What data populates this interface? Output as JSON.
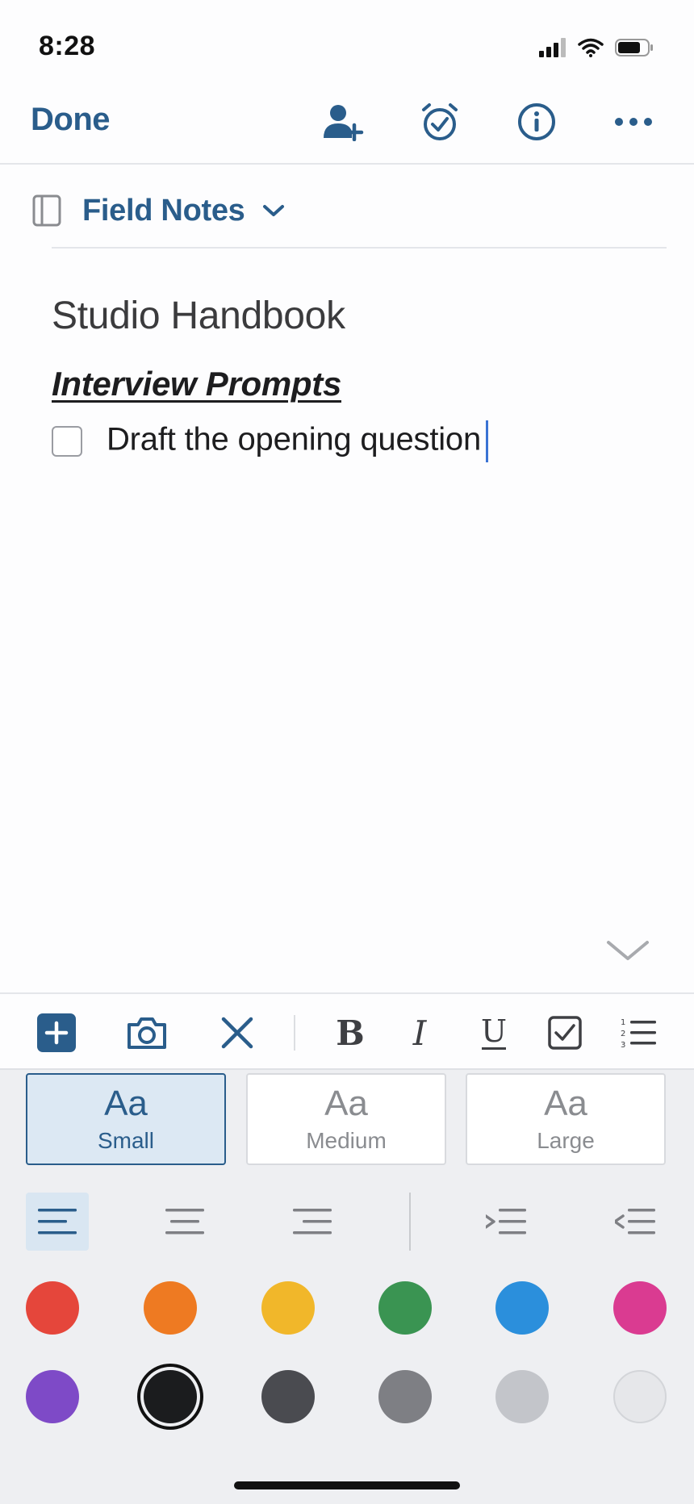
{
  "status": {
    "time": "8:28"
  },
  "toolbar": {
    "done_label": "Done"
  },
  "notebook": {
    "name": "Field Notes"
  },
  "note": {
    "title": "Studio Handbook",
    "heading": "Interview Prompts",
    "todo_text": "Draft the opening question"
  },
  "text_sizes": [
    {
      "aa": "Aa",
      "label": "Small",
      "active": true
    },
    {
      "aa": "Aa",
      "label": "Medium",
      "active": false
    },
    {
      "aa": "Aa",
      "label": "Large",
      "active": false
    }
  ],
  "colors": {
    "accent": "#2a5d8b",
    "swatches": [
      "#e5463b",
      "#ee7a22",
      "#f1b72a",
      "#3a9452",
      "#2b8fdc",
      "#da3b91",
      "#7e4ac7",
      "#1b1c1e",
      "#4a4b50",
      "#7e7f84",
      "#c3c5ca",
      "#e6e7ea"
    ],
    "selected_swatch": "#1b1c1e"
  },
  "icons": {
    "share": "add-person-icon",
    "reminder": "alarm-check-icon",
    "info": "info-icon",
    "more": "more-icon"
  }
}
